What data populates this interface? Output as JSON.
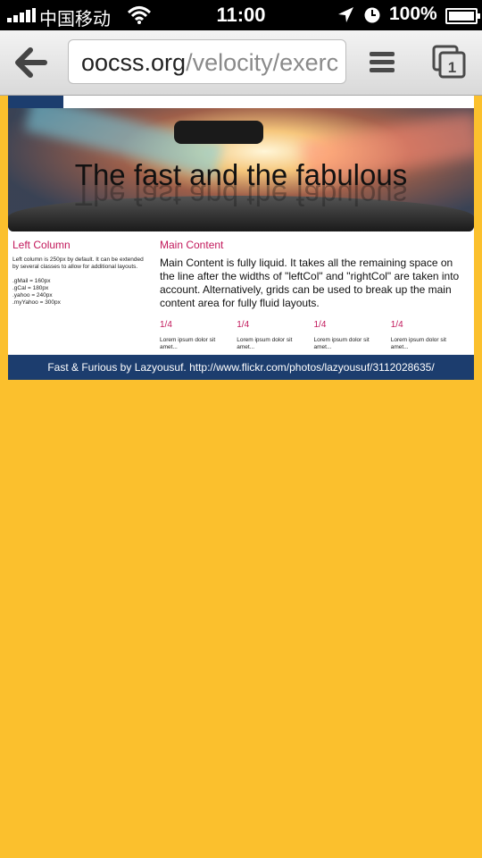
{
  "status_bar": {
    "carrier": "中国移动",
    "time": "11:00",
    "battery": "100%",
    "icons": [
      "signal-icon",
      "wifi-icon",
      "location-icon",
      "clock-icon",
      "battery-icon"
    ]
  },
  "browser": {
    "url_host": "oocss.org",
    "url_path": "/velocity/exerc",
    "tab_count": "1",
    "icons": [
      "back-arrow-icon",
      "menu-icon",
      "tabs-icon"
    ]
  },
  "page": {
    "hero_title": "The fast and the fabulous",
    "left": {
      "heading": "Left Column",
      "desc": "Left column is 250px by default. It can be extended by several classes to allow for additional layouts.",
      "widths": [
        ".gMail = 160px",
        ".gCal = 180px",
        ".yahoo = 240px",
        ".myYahoo = 300px"
      ]
    },
    "main": {
      "heading": "Main Content",
      "text": "Main Content is fully liquid. It takes all the remaining space on the line after the widths of \"leftCol\" and \"rightCol\" are taken into account. Alternatively, grids can be used to break up the main content area for fully fluid layouts.",
      "units": [
        {
          "heading": "1/4",
          "text": "Lorem ipsum dolor sit amet..."
        },
        {
          "heading": "1/4",
          "text": "Lorem ipsum dolor sit amet..."
        },
        {
          "heading": "1/4",
          "text": "Lorem ipsum dolor sit amet..."
        },
        {
          "heading": "1/4",
          "text": "Lorem ipsum dolor sit amet..."
        }
      ]
    },
    "footer": "Fast & Furious by Lazyousuf. http://www.flickr.com/photos/lazyousuf/3112028635/"
  },
  "colors": {
    "page_background": "#fbc02d",
    "accent_pink": "#c2185b",
    "navy": "#1c3d6e"
  }
}
